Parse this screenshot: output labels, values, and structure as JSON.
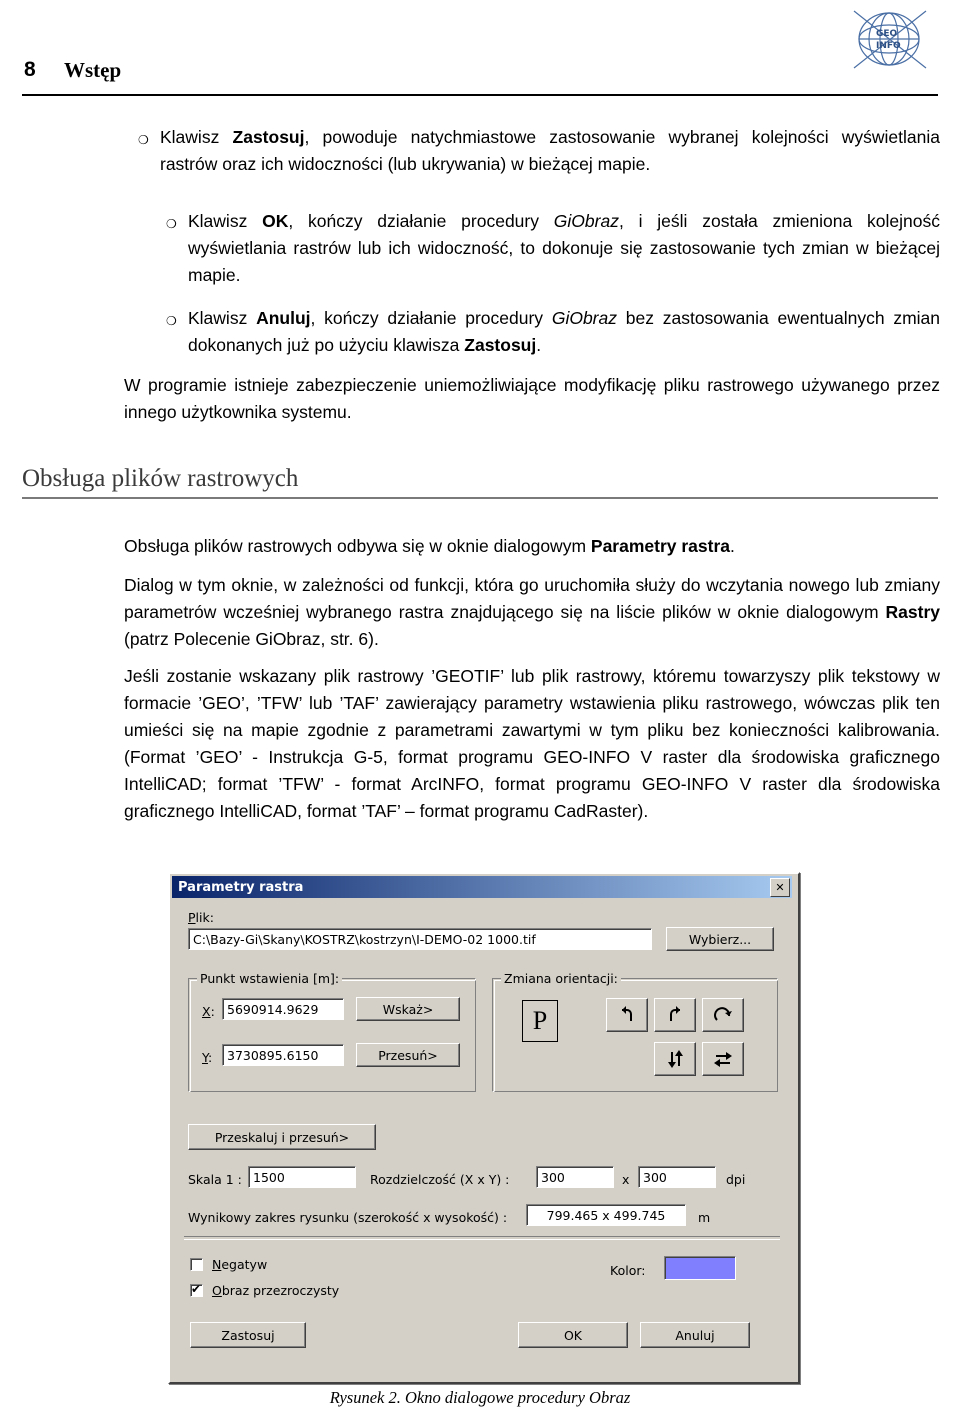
{
  "header": {
    "page_number": "8",
    "title": "Wstęp",
    "logo_alt": "geo-info-logo"
  },
  "bullets": [
    {
      "marker": "❍",
      "html": "Klawisz <b>Zastosuj</b>, powoduje natychmiastowe zastosowanie wybranej kolejności wyświetlania rastrów oraz ich widoczności (lub ukrywania) w bieżącej mapie."
    },
    {
      "marker": "❍",
      "html": "Klawisz <b>OK</b>, kończy działanie procedury <i>GiObraz</i>, i jeśli została zmieniona kolejność wyświetlania rastrów lub ich widoczność, to dokonuje się zastosowanie tych zmian w bieżącej mapie."
    },
    {
      "marker": "❍",
      "html": "Klawisz <b>Anuluj</b>, kończy działanie procedury <i>GiObraz</i> bez zastosowania ewentualnych zmian dokonanych już po użyciu klawisza <b>Zastosuj</b>."
    }
  ],
  "paragraphs": {
    "p_protection": "W programie istnieje zabezpieczenie uniemożliwiające modyfikację pliku rastrowego używanego przez innego użytkownika systemu.",
    "p_obsluga": "Obsługa plików rastrowych odbywa się w oknie dialogowym <b>Parametry rastra</b>.",
    "p_dialog": "Dialog w tym oknie, w zależności od funkcji, która go uruchomiła służy do wczytania nowego lub zmiany parametrów wcześniej wybranego rastra znajdującego się na liście plików w oknie dialogowym <b>Rastry</b> (patrz Polecenie GiObraz, str. 6).",
    "p_geotif": "Jeśli zostanie wskazany plik rastrowy ’GEOTIF’ lub plik rastrowy, któremu towarzyszy plik tekstowy w formacie ’GEO’, ’TFW’ lub ’TAF’ zawierający parametry wstawienia pliku rastrowego, wówczas plik ten umieści się na mapie zgodnie z parametrami zawartymi w tym pliku bez konieczności kalibrowania. (Format ’GEO’ - Instrukcja G-5, format programu GEO-INFO V raster dla środowiska graficznego IntelliCAD; format ’TFW’ - format ArcINFO, format programu GEO-INFO V raster dla środowiska graficznego IntelliCAD, format ’TAF’ – format programu CadRaster)."
  },
  "section_heading": "Obsługa plików rastrowych",
  "dialog": {
    "title": "Parametry rastra",
    "close_label": "✕",
    "plik_label": "Plik:",
    "plik_value": "C:\\Bazy-Gi\\Skany\\KOSTRZ\\kostrzyn\\I-DEMO-02 1000.tif",
    "wybierz_button": "Wybierz...",
    "punkt_group": "Punkt wstawienia [m]:",
    "x_label": "X:",
    "x_value": "5690914.9629",
    "y_label": "Y:",
    "y_value": "3730895.6150",
    "wskaz_button": "Wskaż>",
    "przesun_button": "Przesuń>",
    "orientacja_group": "Zmiana orientacji:",
    "orient_preview": "P",
    "orient_buttons": [
      "rotate-left-icon",
      "rotate-right-icon",
      "rotate-cw-icon",
      "flip-vertical-icon",
      "flip-horizontal-icon"
    ],
    "przeskaluj_button": "Przeskaluj i przesuń>",
    "skala_label": "Skala 1 :",
    "skala_value": "1500",
    "rozdzielczosc_label": "Rozdzielczość (X x Y) :",
    "res_x": "300",
    "res_mult": "x",
    "res_y": "300",
    "dpi_label": "dpi",
    "zakres_label": "Wynikowy zakres rysunku (szerokość x wysokość) :",
    "zakres_value": "799.465  x  499.745",
    "zakres_unit": "m",
    "negatyw_label": "Negatyw",
    "negatyw_checked": false,
    "przezroczysty_label": "Obraz przezroczysty",
    "przezroczysty_checked": true,
    "kolor_label": "Kolor:",
    "kolor_value": "#8080ff",
    "zastosuj_button": "Zastosuj",
    "ok_button": "OK",
    "anuluj_button": "Anuluj"
  },
  "figure_caption": "Rysunek 2. Okno dialogowe procedury Obraz"
}
